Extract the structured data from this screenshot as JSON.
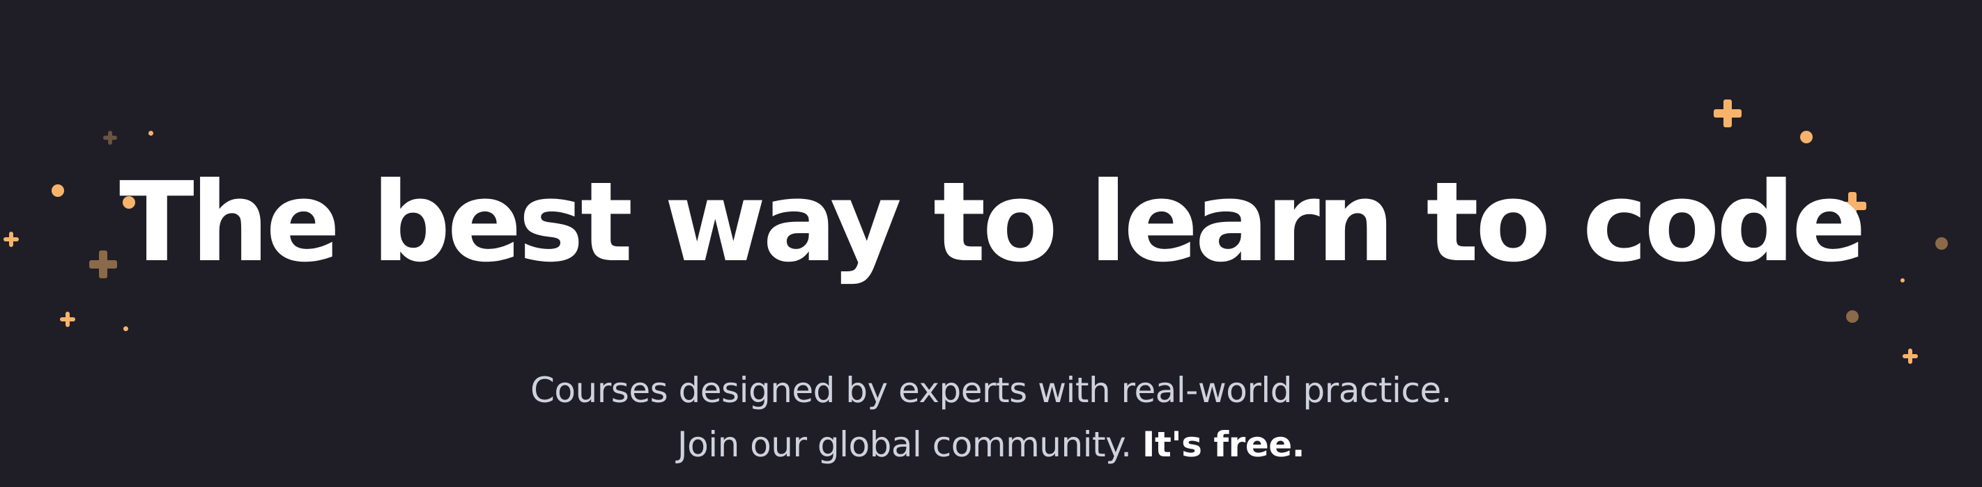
{
  "hero": {
    "headline": "The best way to learn to code",
    "subtitle": {
      "line1": "Courses designed by experts with real-world practice.",
      "line2_prefix": "Join our global community.",
      "line2_emphasis": "It's free."
    }
  },
  "colors": {
    "background": "#1f1e27",
    "headline": "#ffffff",
    "subtitle": "#cfd2dc",
    "accent": "#f7b36b",
    "accent_dim": "#7a5a3e"
  },
  "icons": [
    "sparkle-cross-icon",
    "sparkle-dot-icon"
  ]
}
